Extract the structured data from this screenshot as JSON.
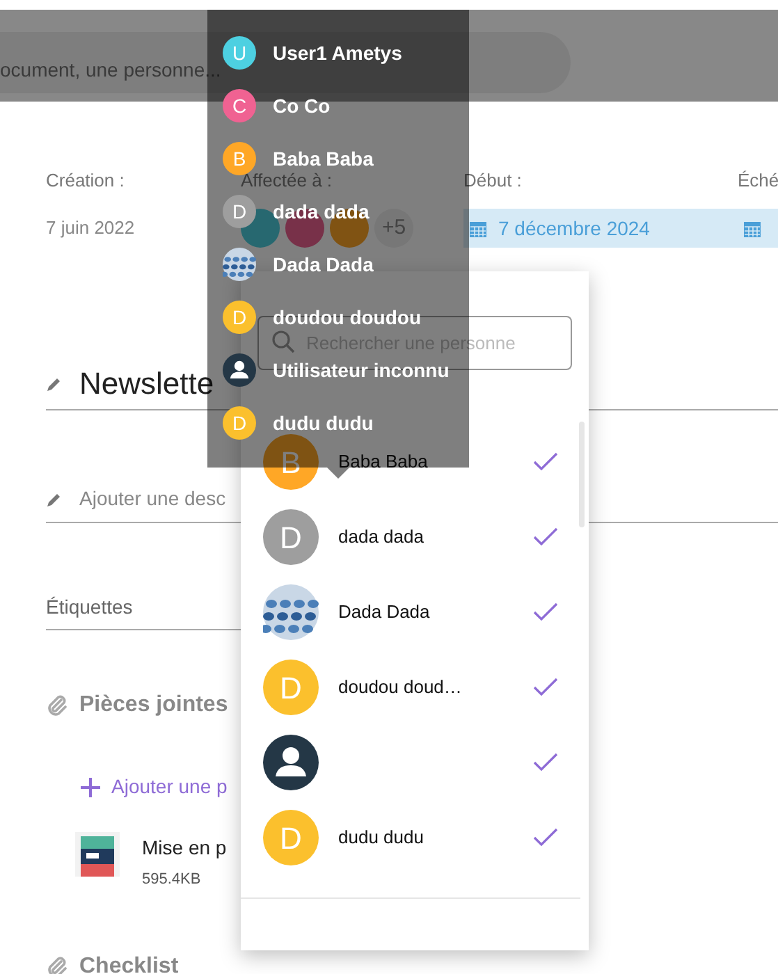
{
  "header": {
    "search_placeholder": "ocument, une personne..."
  },
  "meta": [
    {
      "kind": "text",
      "label": "Création :",
      "value": "7 juin 2022"
    },
    {
      "kind": "avatars",
      "label": "Affectée à :",
      "avatars": [
        {
          "color": "#276870"
        },
        {
          "color": "#783149"
        },
        {
          "color": "#805313"
        }
      ],
      "more": "+5"
    },
    {
      "kind": "date",
      "label": "Début :",
      "value": "7 décembre 2024"
    },
    {
      "kind": "date",
      "label": "Éché"
    }
  ],
  "title": "Newslette",
  "description_placeholder": "Ajouter une desc",
  "tags_label": "Étiquettes",
  "attachments": {
    "title": "Pièces jointes",
    "add": "Ajouter une p",
    "files": [
      {
        "name": "Mise en p",
        "size": "595.4KB"
      }
    ]
  },
  "checklist": {
    "title": "Checklist"
  },
  "picker": {
    "search_placeholder": "Rechercher une personne",
    "people": [
      {
        "kind": "initial",
        "initial": "B",
        "color": "#ffa726",
        "name": "Baba Baba",
        "selected": true
      },
      {
        "kind": "initial",
        "initial": "D",
        "color": "#9e9e9e",
        "name": "dada dada",
        "selected": true
      },
      {
        "kind": "picture",
        "name": "Dada Dada",
        "selected": true
      },
      {
        "kind": "initial",
        "initial": "D",
        "color": "#fbc02d",
        "name": "doudou doud…",
        "selected": true
      },
      {
        "kind": "unknown",
        "selected": true
      },
      {
        "kind": "initial",
        "initial": "D",
        "color": "#fbc02d",
        "name": "dudu dudu",
        "selected": true
      }
    ]
  },
  "tooltip": {
    "people": [
      {
        "kind": "initial",
        "initial": "U",
        "color": "#4dd0e1",
        "name": "User1 Ametys"
      },
      {
        "kind": "initial",
        "initial": "C",
        "color": "#f06292",
        "name": "Co Co"
      },
      {
        "kind": "initial",
        "initial": "B",
        "color": "#ffa726",
        "name": "Baba Baba"
      },
      {
        "kind": "initial",
        "initial": "D",
        "color": "#9e9e9e",
        "name": "dada dada"
      },
      {
        "kind": "picture",
        "name": "Dada Dada"
      },
      {
        "kind": "initial",
        "initial": "D",
        "color": "#fbc02d",
        "name": "doudou doudou"
      },
      {
        "kind": "unknown",
        "name": "Utilisateur inconnu"
      },
      {
        "kind": "initial",
        "initial": "D",
        "color": "#fbc02d",
        "name": "dudu dudu"
      }
    ]
  }
}
